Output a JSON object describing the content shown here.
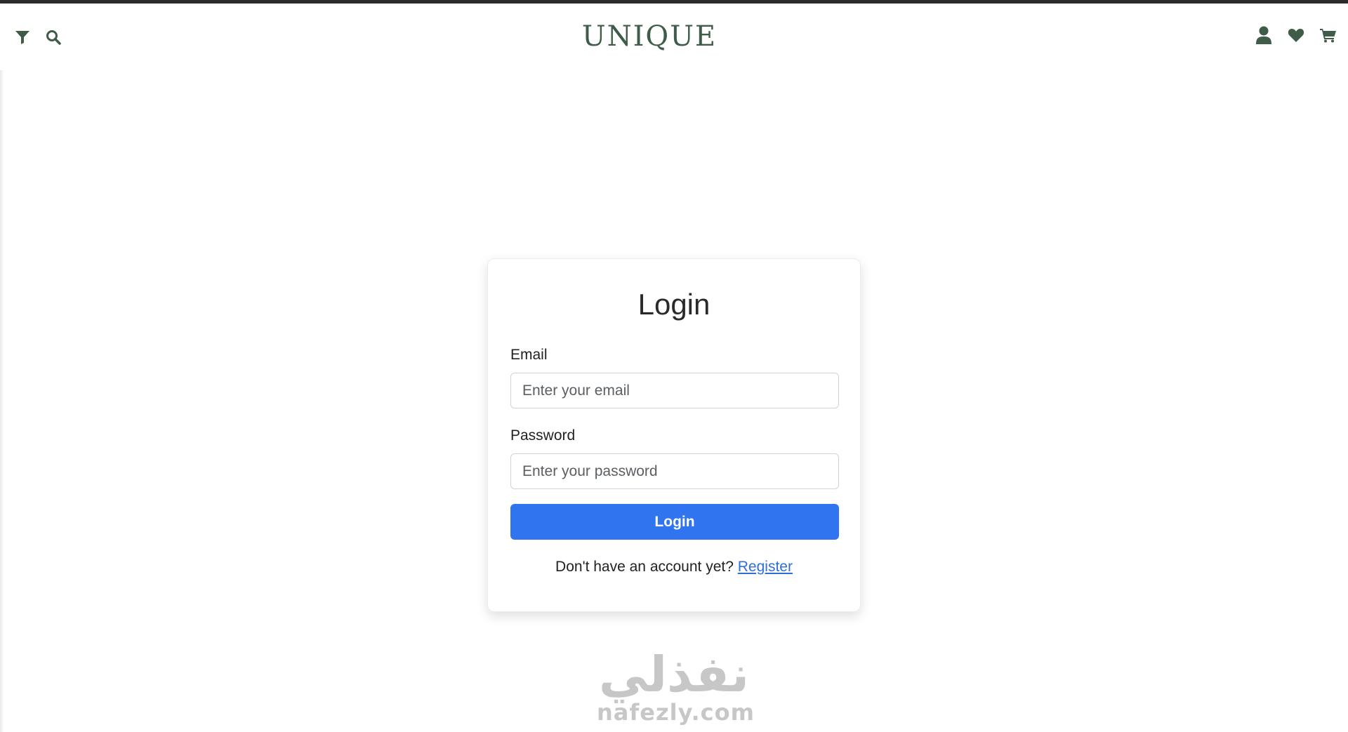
{
  "header": {
    "brand": "UNIQUE",
    "left_icons": [
      "filter-icon",
      "search-icon"
    ],
    "right_icons": [
      "user-icon",
      "heart-icon",
      "cart-icon"
    ],
    "icon_color": "#3e5c48"
  },
  "login": {
    "title": "Login",
    "email_label": "Email",
    "email_placeholder": "Enter your email",
    "password_label": "Password",
    "password_placeholder": "Enter your password",
    "submit_label": "Login",
    "register_prompt": "Don't have an account yet?",
    "register_link": "Register",
    "accent_color": "#3075ef"
  },
  "watermark": {
    "logo_text": "نفذلي",
    "url": "nafezly.com"
  }
}
